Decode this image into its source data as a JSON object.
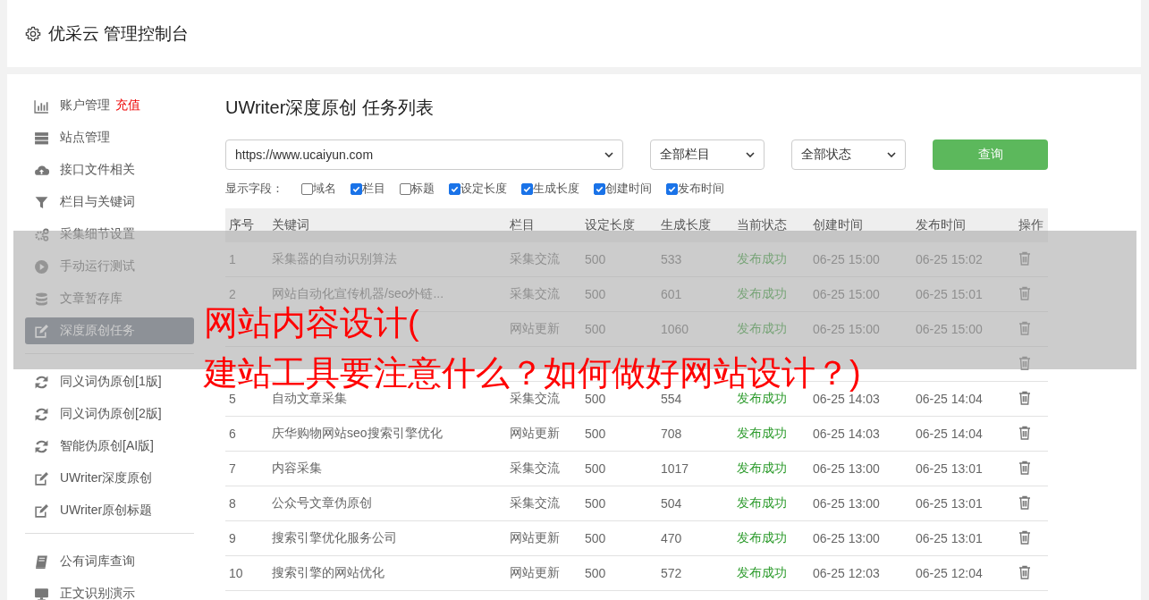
{
  "header": {
    "title": "优采云 管理控制台"
  },
  "sidebar": {
    "groups": [
      [
        {
          "label": "账户管理",
          "badge": "充值",
          "selected": false
        },
        {
          "label": "站点管理",
          "selected": false
        },
        {
          "label": "接口文件相关",
          "selected": false
        },
        {
          "label": "栏目与关键词",
          "selected": false
        },
        {
          "label": "采集细节设置",
          "selected": false
        },
        {
          "label": "手动运行测试",
          "selected": false
        },
        {
          "label": "文章暂存库",
          "selected": false
        },
        {
          "label": "深度原创任务",
          "selected": true
        }
      ],
      [
        {
          "label": "同义词伪原创[1版]",
          "selected": false
        },
        {
          "label": "同义词伪原创[2版]",
          "selected": false
        },
        {
          "label": "智能伪原创[AI版]",
          "selected": false
        },
        {
          "label": "UWriter深度原创",
          "selected": false
        },
        {
          "label": "UWriter原创标题",
          "selected": false
        }
      ],
      [
        {
          "label": "公有词库查询",
          "selected": false
        },
        {
          "label": "正文识别演示",
          "selected": false
        }
      ]
    ]
  },
  "main": {
    "title": "UWriter深度原创 任务列表",
    "filters": {
      "site": "https://www.ucaiyun.com",
      "column": "全部栏目",
      "status": "全部状态",
      "button": "查询"
    },
    "fields_label": "显示字段：",
    "fields": [
      {
        "label": "域名",
        "checked": false
      },
      {
        "label": "栏目",
        "checked": true
      },
      {
        "label": "标题",
        "checked": false
      },
      {
        "label": "设定长度",
        "checked": true
      },
      {
        "label": "生成长度",
        "checked": true
      },
      {
        "label": "创建时间",
        "checked": true
      },
      {
        "label": "发布时间",
        "checked": true
      }
    ],
    "table": {
      "columns": [
        "序号",
        "关键词",
        "栏目",
        "设定长度",
        "生成长度",
        "当前状态",
        "创建时间",
        "发布时间",
        "操作"
      ],
      "rows": [
        [
          "1",
          "采集器的自动识别算法",
          "采集交流",
          "500",
          "533",
          "发布成功",
          "06-25 15:00",
          "06-25 15:02"
        ],
        [
          "2",
          "网站自动化宣传机器/seo外链...",
          "采集交流",
          "500",
          "601",
          "发布成功",
          "06-25 15:00",
          "06-25 15:01"
        ],
        [
          null,
          null,
          "网站更新",
          "500",
          "1060",
          "发布成功",
          "06-25 15:00",
          "06-25 15:00"
        ],
        [
          null,
          null,
          null,
          null,
          null,
          null,
          null,
          null
        ],
        [
          "5",
          "自动文章采集",
          "采集交流",
          "500",
          "554",
          "发布成功",
          "06-25 14:03",
          "06-25 14:04"
        ],
        [
          "6",
          "庆华购物网站seo搜索引擎优化",
          "网站更新",
          "500",
          "708",
          "发布成功",
          "06-25 14:03",
          "06-25 14:04"
        ],
        [
          "7",
          "内容采集",
          "采集交流",
          "500",
          "1017",
          "发布成功",
          "06-25 13:00",
          "06-25 13:01"
        ],
        [
          "8",
          "公众号文章伪原创",
          "采集交流",
          "500",
          "504",
          "发布成功",
          "06-25 13:00",
          "06-25 13:01"
        ],
        [
          "9",
          "搜索引擎优化服务公司",
          "网站更新",
          "500",
          "470",
          "发布成功",
          "06-25 13:00",
          "06-25 13:01"
        ],
        [
          "10",
          "搜索引擎的网站优化",
          "网站更新",
          "500",
          "572",
          "发布成功",
          "06-25 12:03",
          "06-25 12:04"
        ]
      ]
    }
  },
  "overlay": {
    "lines": [
      "网站内容设计(",
      "建站工具要注意什么？如何做好网站设计？)"
    ]
  }
}
